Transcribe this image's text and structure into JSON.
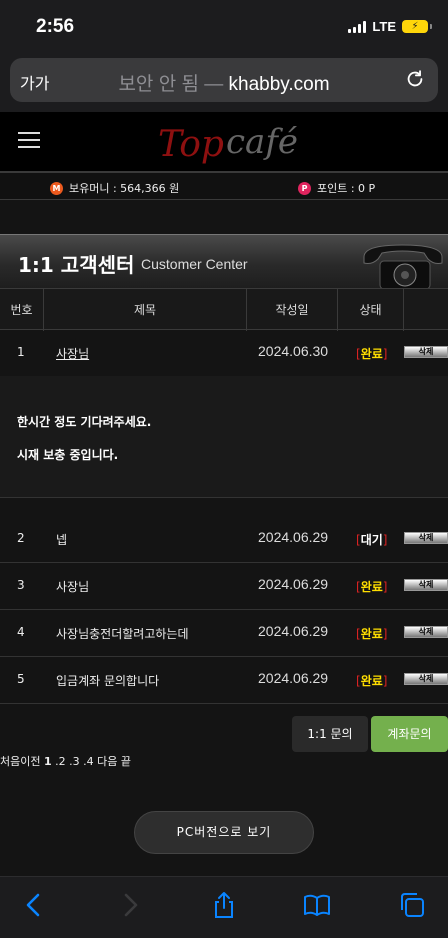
{
  "status_bar": {
    "time": "2:56",
    "network": "LTE"
  },
  "browser": {
    "aa_label": "가가",
    "url_prefix": "보안 안 됨 — ",
    "url_domain": "khabby.com"
  },
  "site": {
    "logo_top": "Top",
    "logo_cafe": "café",
    "money_icon": "M",
    "money_label": "보유머니 : 564,366 원",
    "point_icon": "P",
    "point_label": "포인트 : 0 P"
  },
  "center": {
    "title": "1:1 고객센터",
    "subtitle": "Customer Center"
  },
  "table": {
    "headers": {
      "no": "번호",
      "title": "제목",
      "date": "작성일",
      "status": "상태"
    },
    "delete_label": "삭제",
    "rows": [
      {
        "no": "1",
        "title": "사장님",
        "date": "2024.06.30",
        "status": "완료"
      },
      {
        "no": "2",
        "title": "넵",
        "date": "2024.06.29",
        "status": "대기"
      },
      {
        "no": "3",
        "title": "사장님",
        "date": "2024.06.29",
        "status": "완료"
      },
      {
        "no": "4",
        "title": "사장님충전더할려고하는데",
        "date": "2024.06.29",
        "status": "완료"
      },
      {
        "no": "5",
        "title": "입금계좌 문의합니다",
        "date": "2024.06.29",
        "status": "완료"
      }
    ],
    "answer": {
      "line1": "한시간 정도 기다려주세요.",
      "line2": "시재 보충 중입니다."
    }
  },
  "buttons": {
    "inquiry": "1:1 문의",
    "account": "계좌문의",
    "pc_view": "PC버전으로 보기"
  },
  "pager": {
    "first_prev": "처음이전 ",
    "current": "1",
    "rest": " .2 .3 .4 다음 끝"
  },
  "colors": {
    "accent_green": "#74b04d",
    "done_yellow": "#ffde00",
    "bracket_red": "#d22222",
    "ios_blue": "#0a84ff"
  }
}
